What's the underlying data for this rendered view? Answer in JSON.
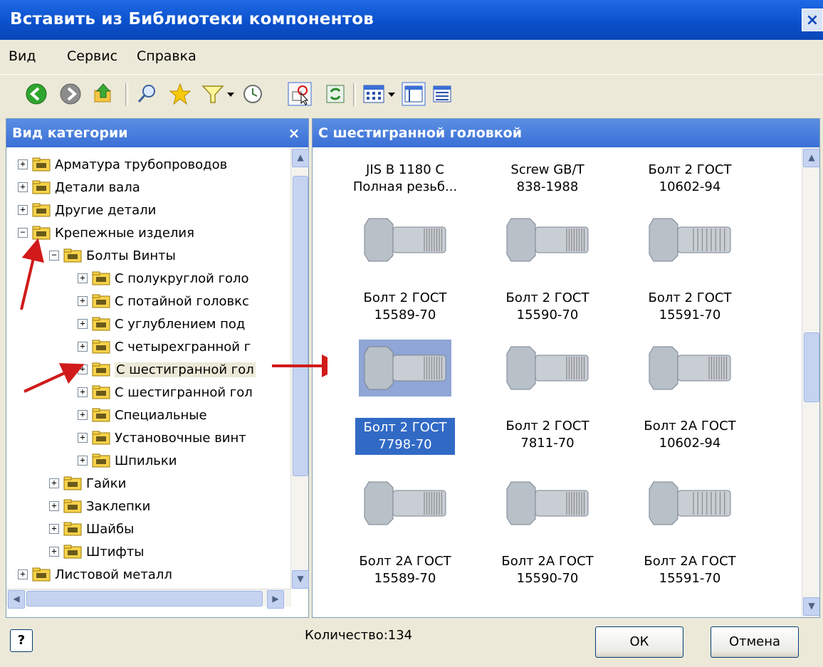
{
  "window": {
    "title": "Вставить из Библиотеки компонентов",
    "close": "×"
  },
  "menu": [
    "Вид",
    "Сервис",
    "Справка"
  ],
  "left_panel": {
    "title": "Вид категории",
    "close": "×",
    "tree": [
      {
        "label": "Арматура трубопроводов",
        "level": 0,
        "expander": "+"
      },
      {
        "label": "Детали вала",
        "level": 0,
        "expander": "+"
      },
      {
        "label": "Другие детали",
        "level": 0,
        "expander": "+"
      },
      {
        "label": "Крепежные изделия",
        "level": 0,
        "expander": "−"
      },
      {
        "label": "Болты  Винты",
        "level": 1,
        "expander": "−"
      },
      {
        "label": "С полукруглой голо",
        "level": 2,
        "expander": "+"
      },
      {
        "label": "С потайной головкс",
        "level": 2,
        "expander": "+"
      },
      {
        "label": "С углублением под",
        "level": 2,
        "expander": "+"
      },
      {
        "label": "С четырехгранной г",
        "level": 2,
        "expander": "+"
      },
      {
        "label": "С шестигранной гол",
        "level": 2,
        "expander": "+"
      },
      {
        "label": "С шестигранной гол",
        "level": 2,
        "expander": "+"
      },
      {
        "label": "Специальные",
        "level": 2,
        "expander": "+"
      },
      {
        "label": "Установочные винт",
        "level": 2,
        "expander": "+"
      },
      {
        "label": "Шпильки",
        "level": 2,
        "expander": "+"
      },
      {
        "label": "Гайки",
        "level": 1,
        "expander": "+"
      },
      {
        "label": "Заклепки",
        "level": 1,
        "expander": "+"
      },
      {
        "label": "Шайбы",
        "level": 1,
        "expander": "+"
      },
      {
        "label": "Штифты",
        "level": 1,
        "expander": "+"
      },
      {
        "label": "Листовой металл",
        "level": 0,
        "expander": "+"
      }
    ]
  },
  "right_panel": {
    "title": "С шестигранной головкой",
    "items": [
      {
        "line1": "JIS B 1180 C",
        "line2": "Полная резьб...",
        "has_image": false
      },
      {
        "line1": "Screw GB/T",
        "line2": "838-1988",
        "has_image": false
      },
      {
        "line1": "Болт 2 ГОСТ",
        "line2": "10602-94",
        "has_image": false
      },
      {
        "line1": "Болт 2 ГОСТ",
        "line2": "15589-70",
        "has_image": true,
        "thread": "short"
      },
      {
        "line1": "Болт 2 ГОСТ",
        "line2": "15590-70",
        "has_image": true,
        "thread": "short"
      },
      {
        "line1": "Болт 2 ГОСТ",
        "line2": "15591-70",
        "has_image": true,
        "thread": "long"
      },
      {
        "line1": "Болт 2 ГОСТ",
        "line2": "7798-70",
        "has_image": true,
        "selected": true,
        "thread": "short"
      },
      {
        "line1": "Болт 2 ГОСТ",
        "line2": "7811-70",
        "has_image": true,
        "thread": "short"
      },
      {
        "line1": "Болт 2А ГОСТ",
        "line2": "10602-94",
        "has_image": true,
        "thread": "short"
      },
      {
        "line1": "Болт 2А ГОСТ",
        "line2": "15589-70",
        "has_image": true,
        "thread": "short"
      },
      {
        "line1": "Болт 2А ГОСТ",
        "line2": "15590-70",
        "has_image": true,
        "thread": "short"
      },
      {
        "line1": "Болт 2А ГОСТ",
        "line2": "15591-70",
        "has_image": true,
        "thread": "long"
      }
    ]
  },
  "status": {
    "count": "Количество:134"
  },
  "buttons": {
    "ok": "ОК",
    "cancel": "Отмена",
    "help": "?"
  },
  "colors": {
    "title_bar": "#0a4fc9",
    "panel_header": "#3a6fd6",
    "selection": "#316ac5",
    "arrow": "#d11a1a"
  }
}
